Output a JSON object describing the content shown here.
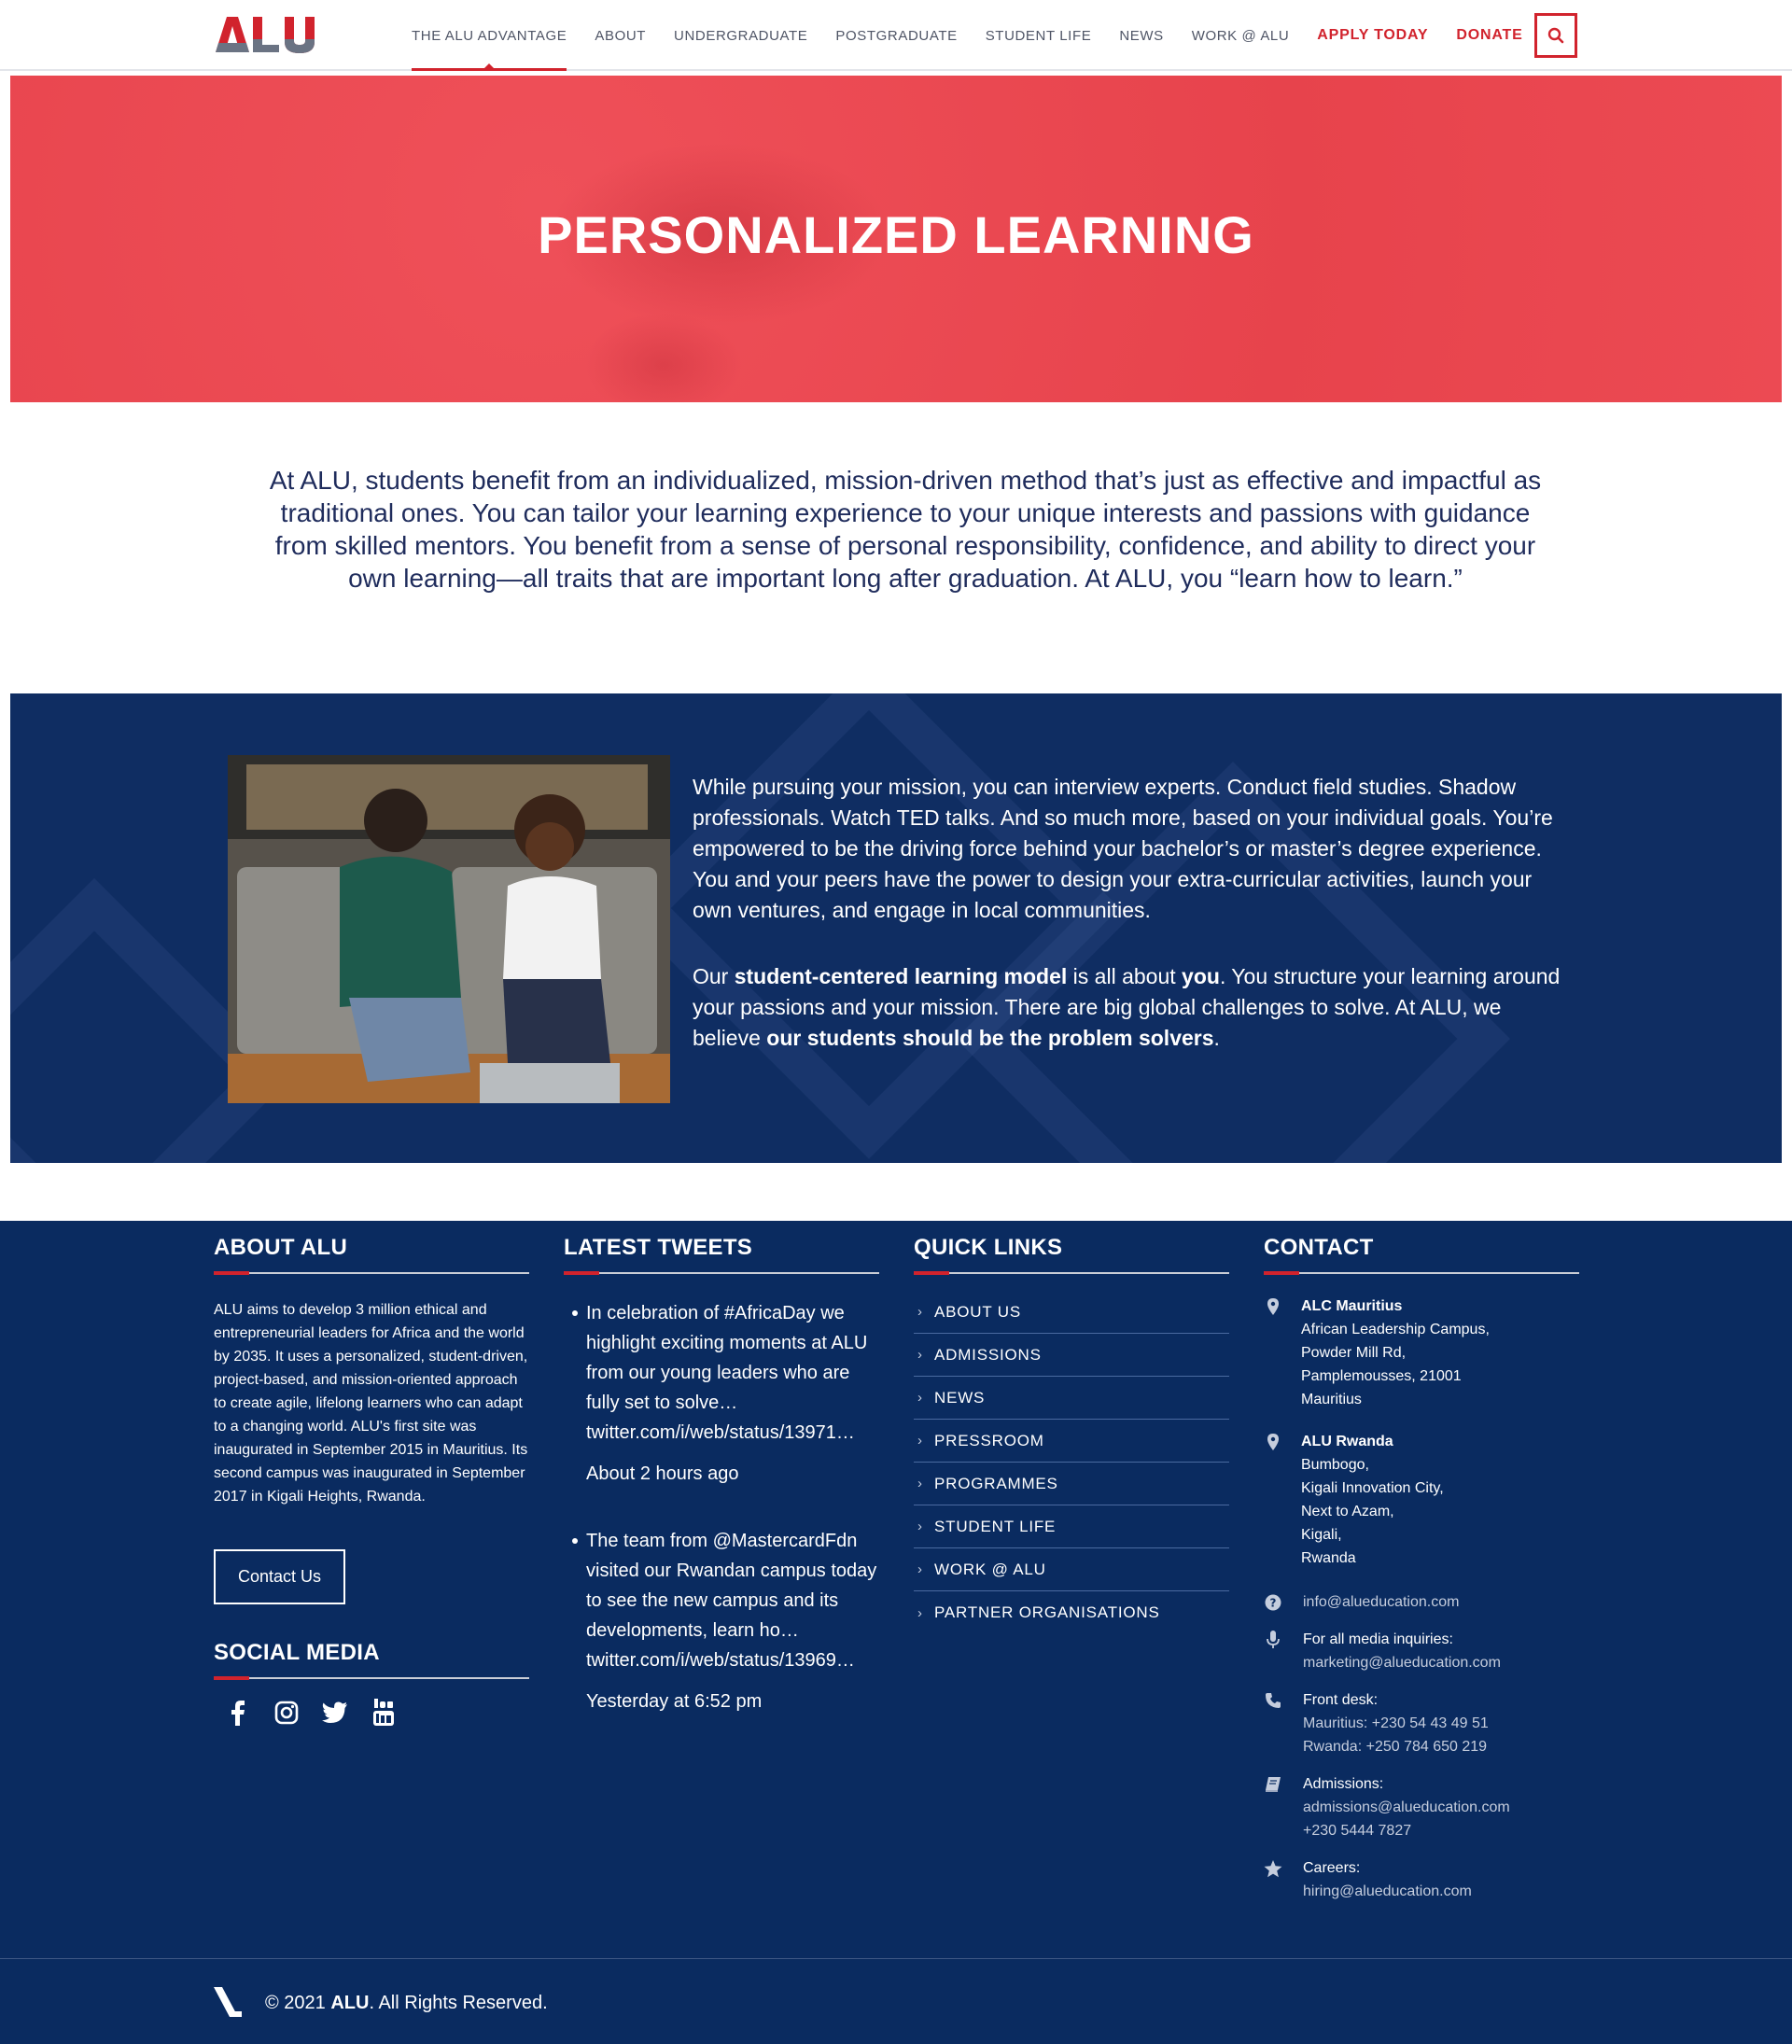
{
  "brand": {
    "logo_text": "ALU",
    "accent": "#d1232d",
    "navy": "#0a2b60",
    "logo_grey": "#6a7383"
  },
  "nav": {
    "items": [
      {
        "label": "THE ALU ADVANTAGE",
        "active": true
      },
      {
        "label": "ABOUT"
      },
      {
        "label": "UNDERGRADUATE"
      },
      {
        "label": "POSTGRADUATE"
      },
      {
        "label": "STUDENT LIFE"
      },
      {
        "label": "NEWS"
      },
      {
        "label": "WORK @ ALU"
      }
    ],
    "apply_label": "APPLY TODAY",
    "donate_label": "DONATE",
    "search_icon": "search-icon"
  },
  "hero": {
    "title": "PERSONALIZED LEARNING"
  },
  "intro": {
    "text": "At ALU, students benefit from an individualized, mission-driven method that’s just as effective and impactful as traditional ones. You can tailor your learning experience to your unique interests and passions with guidance from skilled mentors. You benefit from a sense of personal responsibility, confidence, and ability to direct your own learning—all traits that are important long after graduation. At ALU, you “learn how to learn.”"
  },
  "feature": {
    "paragraph1": "While pursuing your mission, you can interview experts. Conduct field studies. Shadow professionals. Watch TED talks. And so much more, based on your individual goals. You’re empowered to be the driving force behind your bachelor’s or master’s degree experience. You and your peers have the power to design your extra-curricular activities, launch your own ventures, and engage in local communities.",
    "p2_a": "Our ",
    "p2_b": "student-centered learning model",
    "p2_c": " is all about ",
    "p2_d": "you",
    "p2_e": ". You structure your learning around your passions and your mission. There are big global challenges to solve. At ALU, we believe ",
    "p2_f": "our students should be the problem solvers",
    "p2_g": "."
  },
  "footer": {
    "about": {
      "title": "ABOUT ALU",
      "text": "ALU aims to develop 3 million ethical and entrepreneurial leaders for Africa and the world by 2035. It uses a personalized, student-driven, project-based, and mission-oriented approach to create agile, lifelong learners who can adapt to a changing world. ALU's first site was inaugurated in September 2015 in Mauritius. Its second campus was inaugurated in September 2017 in Kigali Heights, Rwanda.",
      "contact_button": "Contact Us",
      "social_title": "SOCIAL MEDIA",
      "social_icons": [
        "facebook-icon",
        "instagram-icon",
        "twitter-icon",
        "youtube-icon"
      ]
    },
    "tweets": {
      "title": "LATEST TWEETS",
      "items": [
        {
          "text": "In celebration of #AfricaDay we highlight exciting moments at ALU from our young leaders who are fully set to solve…",
          "link": "twitter.com/i/web/status/13971…",
          "time": "About 2 hours ago"
        },
        {
          "text": "The team from @MastercardFdn visited our Rwandan campus today to see the new campus and its developments, learn ho…",
          "link": "twitter.com/i/web/status/13969…",
          "time": "Yesterday at 6:52 pm"
        }
      ]
    },
    "quick_links": {
      "title": "QUICK LINKS",
      "items": [
        "ABOUT US",
        "ADMISSIONS",
        "NEWS",
        "PRESSROOM",
        "PROGRAMMES",
        "STUDENT LIFE",
        "WORK @ ALU",
        "PARTNER ORGANISATIONS"
      ]
    },
    "contact": {
      "title": "CONTACT",
      "mauritius": {
        "name": "ALC Mauritius",
        "lines": [
          "African Leadership Campus,",
          "Powder Mill Rd,",
          "Pamplemousses, 21001",
          "Mauritius"
        ]
      },
      "rwanda": {
        "name": "ALU Rwanda",
        "lines": [
          "Bumbogo,",
          "Kigali Innovation City,",
          "Next to Azam,",
          "Kigali,",
          "Rwanda"
        ]
      },
      "email": "info@alueducation.com",
      "media_label": "For all media inquiries:",
      "media_email": "marketing@alueducation.com",
      "front_desk_label": "Front desk:",
      "front_desk_mu": "Mauritius: +230 54 43 49 51",
      "front_desk_rw": "Rwanda: +250 784 650 219",
      "admissions_label": "Admissions:",
      "admissions_email": "admissions@alueducation.com",
      "admissions_phone": "+230 5444 7827",
      "careers_label": "Careers:",
      "careers_email": "hiring@alueducation.com"
    },
    "copyright_pre": "© 2021 ",
    "copyright_brand": "ALU",
    "copyright_post": ". All Rights Reserved."
  }
}
